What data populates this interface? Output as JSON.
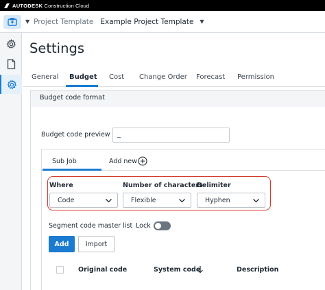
{
  "topbar": {
    "brand_bold": "AUTODESK",
    "brand_product": "Construction Cloud"
  },
  "project_bar": {
    "label": "Project Template",
    "name": "Example Project Template"
  },
  "sidebar": {
    "items": [
      {
        "icon": "gear-icon",
        "active": false
      },
      {
        "icon": "document-icon",
        "active": false
      },
      {
        "icon": "gear-icon",
        "active": true
      }
    ]
  },
  "page": {
    "title": "Settings"
  },
  "tabs": [
    {
      "label": "General",
      "active": false
    },
    {
      "label": "Budget",
      "active": true
    },
    {
      "label": "Cost",
      "active": false
    },
    {
      "label": "Change Order",
      "active": false
    },
    {
      "label": "Forecast",
      "active": false
    },
    {
      "label": "Permission",
      "active": false
    }
  ],
  "budget_code": {
    "section_title": "Budget code format",
    "preview_label": "Budget code preview",
    "preview_value": "_",
    "subtabs": [
      {
        "label": "Sub Job",
        "active": true
      },
      {
        "label": "Add new",
        "active": false
      }
    ],
    "segment": {
      "where_label": "Where",
      "where_value": "Code",
      "chars_label": "Number of characters",
      "chars_value": "Flexible",
      "delimiter_label": "Delimiter",
      "delimiter_value": "Hyphen"
    },
    "master_list_label": "Segment code master list",
    "lock_label": "Lock",
    "lock_on": false,
    "add_button": "Add",
    "import_button": "Import",
    "table_headers": {
      "original_code": "Original code",
      "system_code": "System code",
      "description": "Description"
    }
  },
  "colors": {
    "accent": "#1a7bd1",
    "highlight_border": "#d33a2e",
    "topbar_bg": "#000000"
  }
}
